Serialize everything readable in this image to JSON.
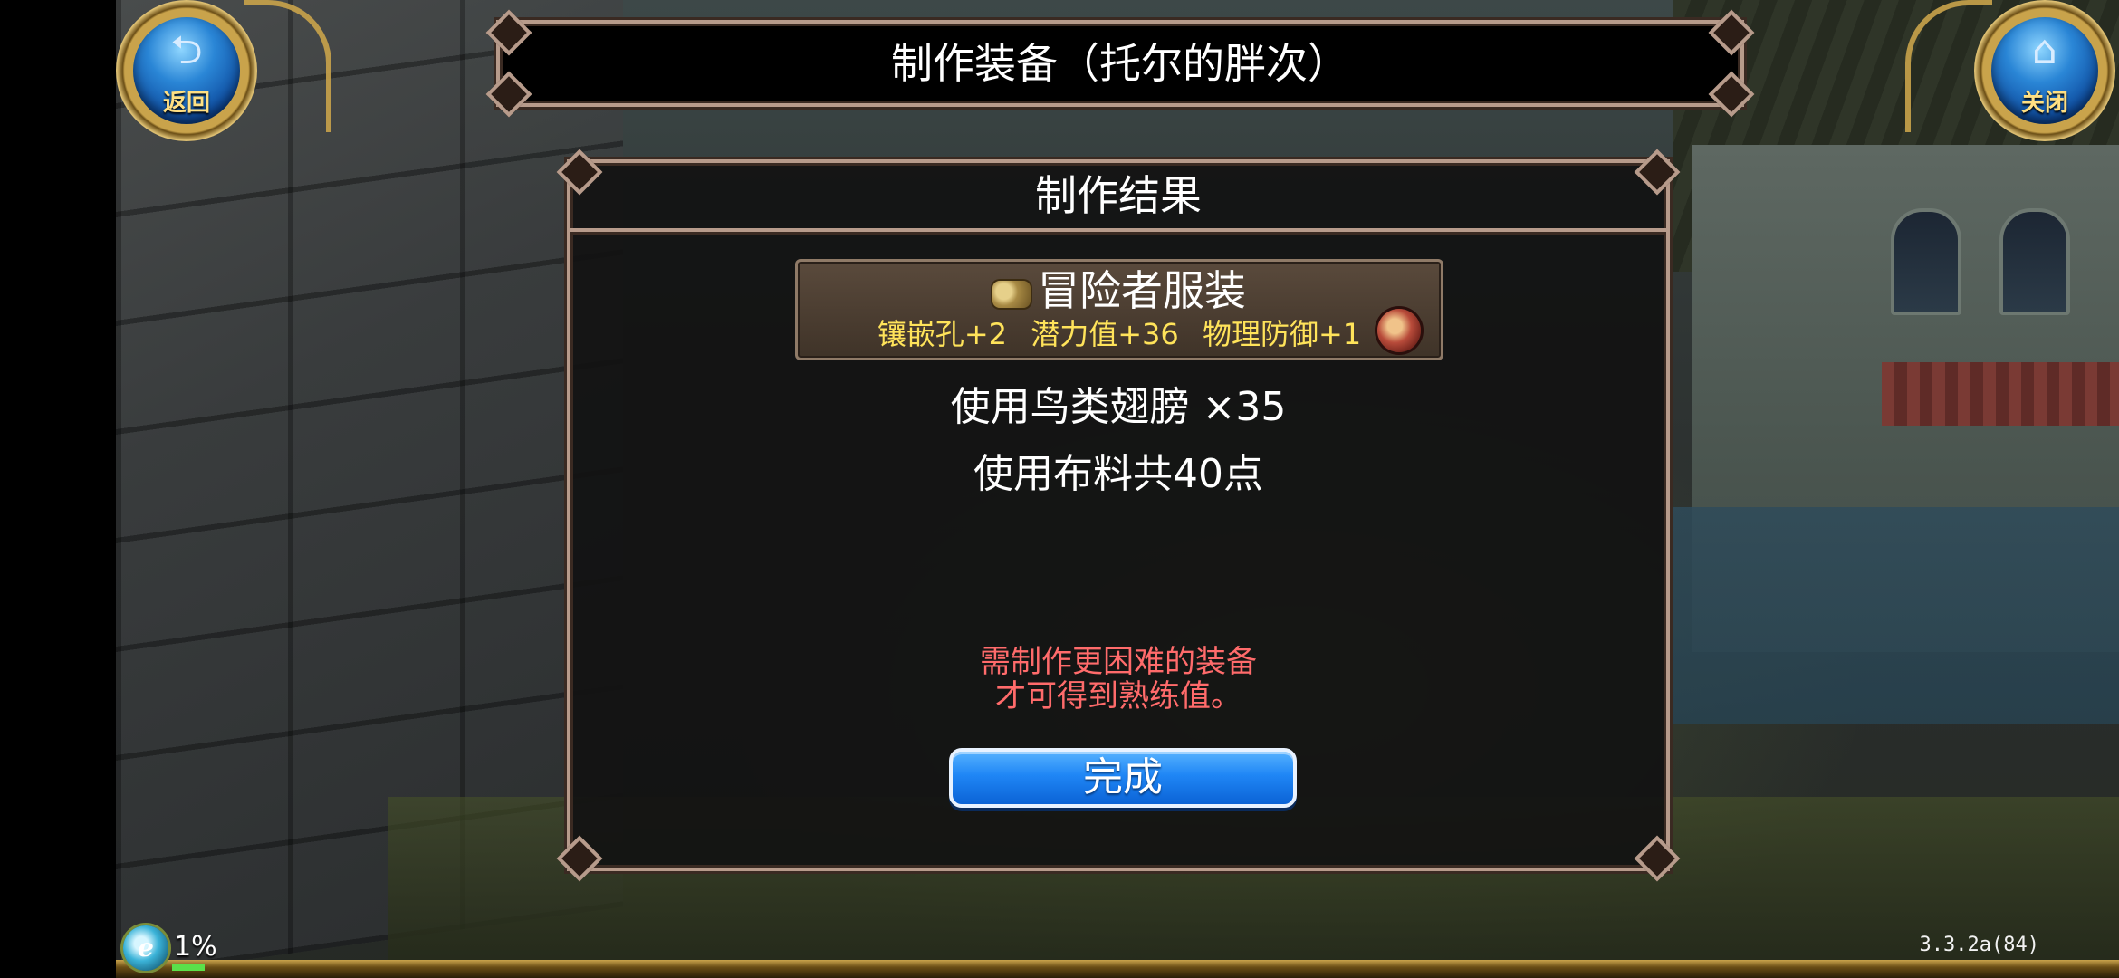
{
  "header": {
    "back_label": "返回",
    "back_icon": "return-arrow-icon",
    "close_label": "关闭",
    "close_icon": "home-icon",
    "title": "制作装备（托尔的胖次）"
  },
  "result_panel": {
    "title": "制作结果",
    "item": {
      "icon": "adventurer-outfit-icon",
      "name": "冒险者服装",
      "stats": [
        "镶嵌孔+2",
        "潜力值+36",
        "物理防御+1"
      ],
      "badge_icon": "treasure-chest-icon"
    },
    "material_line": "使用鸟类翅膀 ×35",
    "cloth_line": "使用布料共40点",
    "notice_line1": "需制作更困难的装备",
    "notice_line2": "才可得到熟练值。",
    "done_label": "完成"
  },
  "hud": {
    "exp_percent": "1%",
    "exp_fraction": 0.01,
    "version": "3.3.2a(84)"
  },
  "colors": {
    "accent_blue": "#1f86f5",
    "frame_gold": "#c9a34b",
    "stat_yellow": "#ffe35a",
    "notice_red": "#ff6b6b"
  }
}
